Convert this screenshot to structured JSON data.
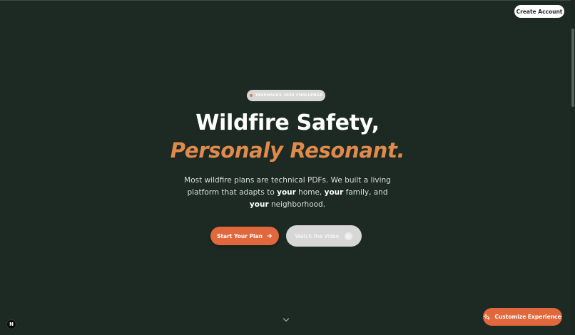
{
  "header": {
    "create_account_label": "Create Account"
  },
  "badge": {
    "text": "TREEHACKS 2026 CHALLENGE"
  },
  "hero": {
    "title": "Wildfire Safety,",
    "subtitle": "Personaly Resonant.",
    "description": {
      "part1": "Most wildfire plans are technical PDFs. We built a living platform that adapts to ",
      "bold1": "your",
      "part2": " home, ",
      "bold2": "your",
      "part3": " family, and ",
      "bold3": "your",
      "part4": " neighborhood."
    }
  },
  "actions": {
    "start_label": "Start Your Plan",
    "watch_label": "Watch the Video"
  },
  "footer": {
    "logo_letter": "N",
    "customize_label": "Customize Experience"
  },
  "colors": {
    "background": "#1d2a23",
    "accent": "#e0683c",
    "subtitle": "#e08a4c"
  }
}
